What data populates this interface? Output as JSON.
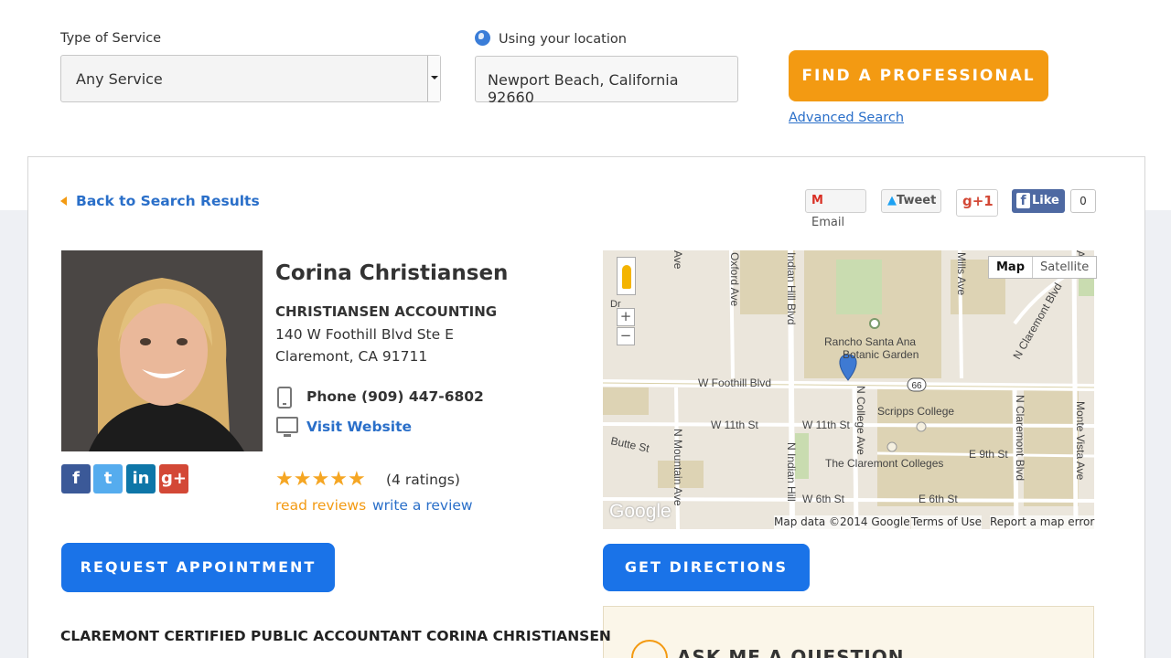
{
  "search": {
    "service_label": "Type of Service",
    "service_value": "Any Service",
    "location_label": "Using your location",
    "location_value": "Newport Beach, California 92660",
    "find_button": "FIND A PROFESSIONAL",
    "advanced_link": "Advanced Search"
  },
  "nav": {
    "back_link": "Back to Search Results"
  },
  "share": {
    "email": "Email",
    "tweet": "Tweet",
    "gplus": "g+1",
    "fb_like": "Like",
    "fb_count": "0"
  },
  "profile": {
    "name": "Corina Christiansen",
    "company": "CHRISTIANSEN ACCOUNTING",
    "address_line1": "140 W Foothill Blvd Ste E",
    "address_line2": "Claremont, CA 91711",
    "phone": "Phone (909) 447-6802",
    "website": "Visit Website",
    "rating": 5,
    "ratings_text": "(4 ratings)",
    "read_reviews": "read reviews",
    "write_review": "write a review",
    "social": [
      "facebook",
      "twitter",
      "linkedin",
      "google-plus"
    ]
  },
  "buttons": {
    "request": "REQUEST APPOINTMENT",
    "directions": "GET DIRECTIONS"
  },
  "map": {
    "type_map": "Map",
    "type_satellite": "Satellite",
    "zoom_in": "+",
    "zoom_out": "−",
    "labels": {
      "rancho1": "Rancho Santa Ana",
      "rancho2": "Botanic Garden",
      "foothill": "W Foothill Blvd",
      "route": "66",
      "scripps": "Scripps College",
      "claremont_colleges": "The Claremont Colleges",
      "w11th_a": "W 11th St",
      "w11th_b": "W 11th St",
      "e9th": "E 9th St",
      "w6th": "W 6th St",
      "e6th": "E 6th St",
      "butte": "Butte St",
      "oxford": "Oxford Ave",
      "indian_hill_blvd": "Indian Hill Blvd",
      "n_indian_hill": "N Indian Hill",
      "mills": "Mills Ave",
      "n_claremont_blvd_top": "N Claremont Blvd",
      "n_claremont_blvd": "N Claremont Blvd",
      "monte_vista": "Monte Vista Ave",
      "n_college": "N College Ave",
      "n_mountain": "N Mountain Ave",
      "dr": "Dr",
      "ave_left": "Ave",
      "ave_right": "Ave"
    },
    "google": "Google",
    "map_data": "Map data ©2014 Google",
    "terms": "Terms of Use",
    "report": "Report a map error"
  },
  "ask": {
    "title": "ASK ME A QUESTION"
  },
  "bio": {
    "title": "CLAREMONT CERTIFIED PUBLIC ACCOUNTANT CORINA CHRISTIANSEN"
  },
  "colors": {
    "accent_orange": "#f39a12",
    "accent_blue": "#1a73e8",
    "link_blue": "#2a6fc9"
  }
}
